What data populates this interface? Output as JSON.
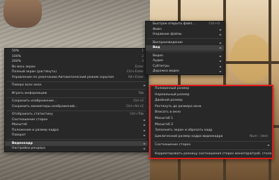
{
  "main_menu": {
    "items": [
      {
        "label": "50%",
        "shortcut": "1"
      },
      {
        "label": "100%",
        "shortcut": "2"
      },
      {
        "label": "200%",
        "shortcut": "3"
      },
      {
        "label": "Во весь экран",
        "shortcut": "Enter"
      },
      {
        "label": "Полный экран (растянуть)",
        "shortcut": "Ctrl+Enter"
      },
      {
        "label": "Управление по умолчанию:Автоматический режим скрытия",
        "shortcut": "Alt+Enter"
      },
      {
        "label": "Поверх всех окон",
        "shortcut": ""
      },
      {
        "label": "Играть информацию",
        "shortcut": "Tab"
      },
      {
        "label": "Сохранить изображение...",
        "shortcut": "Ctrl+E"
      },
      {
        "label": "Сохранить миниатюры изображений...",
        "shortcut": "Ctrl+Alt+E"
      },
      {
        "label": "Отображать статистику",
        "shortcut": "Ctrl+Tab"
      },
      {
        "label": "Соотношение сторон",
        "shortcut": ""
      },
      {
        "label": "Масштаб",
        "shortcut": ""
      },
      {
        "label": "Положение и размер кадра",
        "shortcut": ""
      },
      {
        "label": "Поворот",
        "shortcut": ""
      },
      {
        "label": "Видеокадр",
        "shortcut": ""
      },
      {
        "label": "Настройки рендера",
        "shortcut": ""
      }
    ]
  },
  "file_menu": {
    "items": [
      {
        "label": "Быстрое открыть файл...",
        "shortcut": "Ctrl+O"
      },
      {
        "label": "Файл",
        "shortcut": ""
      },
      {
        "label": "Недавние файлы",
        "shortcut": ""
      },
      {
        "label": "Воспроизведение",
        "shortcut": ""
      },
      {
        "label": "Вид",
        "shortcut": ""
      },
      {
        "label": "Видео",
        "shortcut": ""
      },
      {
        "label": "Аудио",
        "shortcut": ""
      },
      {
        "label": "Субтитры",
        "shortcut": ""
      },
      {
        "label": "Дорожка видео",
        "shortcut": ""
      }
    ]
  },
  "frame_submenu": {
    "items": [
      {
        "label": "Половинный размер",
        "shortcut": ""
      },
      {
        "label": "Нормальный размер",
        "shortcut": ""
      },
      {
        "label": "Двойной размер",
        "shortcut": ""
      },
      {
        "label": "Растянуть до размера окна",
        "shortcut": ""
      },
      {
        "label": "Вписать в окно",
        "shortcut": ""
      },
      {
        "label": "Масштаб 1",
        "shortcut": ""
      },
      {
        "label": "Масштаб 2",
        "shortcut": ""
      },
      {
        "label": "Заполнить экран и обрезать кадр",
        "shortcut": ""
      },
      {
        "label": "Циклический размер кадра видеокадра",
        "shortcut": "Num : (del)"
      },
      {
        "label": "Соотношение сторон",
        "shortcut": ""
      },
      {
        "label": "Корректировать разницу соотношения сторон монитора/граб. стола",
        "shortcut": ""
      }
    ]
  },
  "colors": {
    "menu_bg": "#282828",
    "highlight": "#3f3f3f",
    "outline": "#e01c1c",
    "text": "#d2d2d2"
  }
}
